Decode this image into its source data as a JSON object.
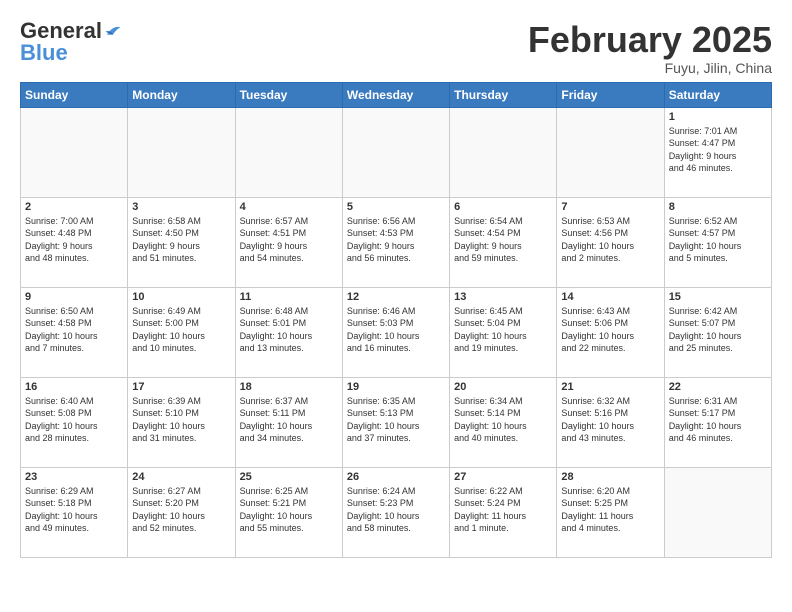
{
  "logo": {
    "general": "General",
    "blue": "Blue"
  },
  "title": "February 2025",
  "location": "Fuyu, Jilin, China",
  "weekdays": [
    "Sunday",
    "Monday",
    "Tuesday",
    "Wednesday",
    "Thursday",
    "Friday",
    "Saturday"
  ],
  "weeks": [
    [
      {
        "day": "",
        "info": ""
      },
      {
        "day": "",
        "info": ""
      },
      {
        "day": "",
        "info": ""
      },
      {
        "day": "",
        "info": ""
      },
      {
        "day": "",
        "info": ""
      },
      {
        "day": "",
        "info": ""
      },
      {
        "day": "1",
        "info": "Sunrise: 7:01 AM\nSunset: 4:47 PM\nDaylight: 9 hours\nand 46 minutes."
      }
    ],
    [
      {
        "day": "2",
        "info": "Sunrise: 7:00 AM\nSunset: 4:48 PM\nDaylight: 9 hours\nand 48 minutes."
      },
      {
        "day": "3",
        "info": "Sunrise: 6:58 AM\nSunset: 4:50 PM\nDaylight: 9 hours\nand 51 minutes."
      },
      {
        "day": "4",
        "info": "Sunrise: 6:57 AM\nSunset: 4:51 PM\nDaylight: 9 hours\nand 54 minutes."
      },
      {
        "day": "5",
        "info": "Sunrise: 6:56 AM\nSunset: 4:53 PM\nDaylight: 9 hours\nand 56 minutes."
      },
      {
        "day": "6",
        "info": "Sunrise: 6:54 AM\nSunset: 4:54 PM\nDaylight: 9 hours\nand 59 minutes."
      },
      {
        "day": "7",
        "info": "Sunrise: 6:53 AM\nSunset: 4:56 PM\nDaylight: 10 hours\nand 2 minutes."
      },
      {
        "day": "8",
        "info": "Sunrise: 6:52 AM\nSunset: 4:57 PM\nDaylight: 10 hours\nand 5 minutes."
      }
    ],
    [
      {
        "day": "9",
        "info": "Sunrise: 6:50 AM\nSunset: 4:58 PM\nDaylight: 10 hours\nand 7 minutes."
      },
      {
        "day": "10",
        "info": "Sunrise: 6:49 AM\nSunset: 5:00 PM\nDaylight: 10 hours\nand 10 minutes."
      },
      {
        "day": "11",
        "info": "Sunrise: 6:48 AM\nSunset: 5:01 PM\nDaylight: 10 hours\nand 13 minutes."
      },
      {
        "day": "12",
        "info": "Sunrise: 6:46 AM\nSunset: 5:03 PM\nDaylight: 10 hours\nand 16 minutes."
      },
      {
        "day": "13",
        "info": "Sunrise: 6:45 AM\nSunset: 5:04 PM\nDaylight: 10 hours\nand 19 minutes."
      },
      {
        "day": "14",
        "info": "Sunrise: 6:43 AM\nSunset: 5:06 PM\nDaylight: 10 hours\nand 22 minutes."
      },
      {
        "day": "15",
        "info": "Sunrise: 6:42 AM\nSunset: 5:07 PM\nDaylight: 10 hours\nand 25 minutes."
      }
    ],
    [
      {
        "day": "16",
        "info": "Sunrise: 6:40 AM\nSunset: 5:08 PM\nDaylight: 10 hours\nand 28 minutes."
      },
      {
        "day": "17",
        "info": "Sunrise: 6:39 AM\nSunset: 5:10 PM\nDaylight: 10 hours\nand 31 minutes."
      },
      {
        "day": "18",
        "info": "Sunrise: 6:37 AM\nSunset: 5:11 PM\nDaylight: 10 hours\nand 34 minutes."
      },
      {
        "day": "19",
        "info": "Sunrise: 6:35 AM\nSunset: 5:13 PM\nDaylight: 10 hours\nand 37 minutes."
      },
      {
        "day": "20",
        "info": "Sunrise: 6:34 AM\nSunset: 5:14 PM\nDaylight: 10 hours\nand 40 minutes."
      },
      {
        "day": "21",
        "info": "Sunrise: 6:32 AM\nSunset: 5:16 PM\nDaylight: 10 hours\nand 43 minutes."
      },
      {
        "day": "22",
        "info": "Sunrise: 6:31 AM\nSunset: 5:17 PM\nDaylight: 10 hours\nand 46 minutes."
      }
    ],
    [
      {
        "day": "23",
        "info": "Sunrise: 6:29 AM\nSunset: 5:18 PM\nDaylight: 10 hours\nand 49 minutes."
      },
      {
        "day": "24",
        "info": "Sunrise: 6:27 AM\nSunset: 5:20 PM\nDaylight: 10 hours\nand 52 minutes."
      },
      {
        "day": "25",
        "info": "Sunrise: 6:25 AM\nSunset: 5:21 PM\nDaylight: 10 hours\nand 55 minutes."
      },
      {
        "day": "26",
        "info": "Sunrise: 6:24 AM\nSunset: 5:23 PM\nDaylight: 10 hours\nand 58 minutes."
      },
      {
        "day": "27",
        "info": "Sunrise: 6:22 AM\nSunset: 5:24 PM\nDaylight: 11 hours\nand 1 minute."
      },
      {
        "day": "28",
        "info": "Sunrise: 6:20 AM\nSunset: 5:25 PM\nDaylight: 11 hours\nand 4 minutes."
      },
      {
        "day": "",
        "info": ""
      }
    ]
  ]
}
